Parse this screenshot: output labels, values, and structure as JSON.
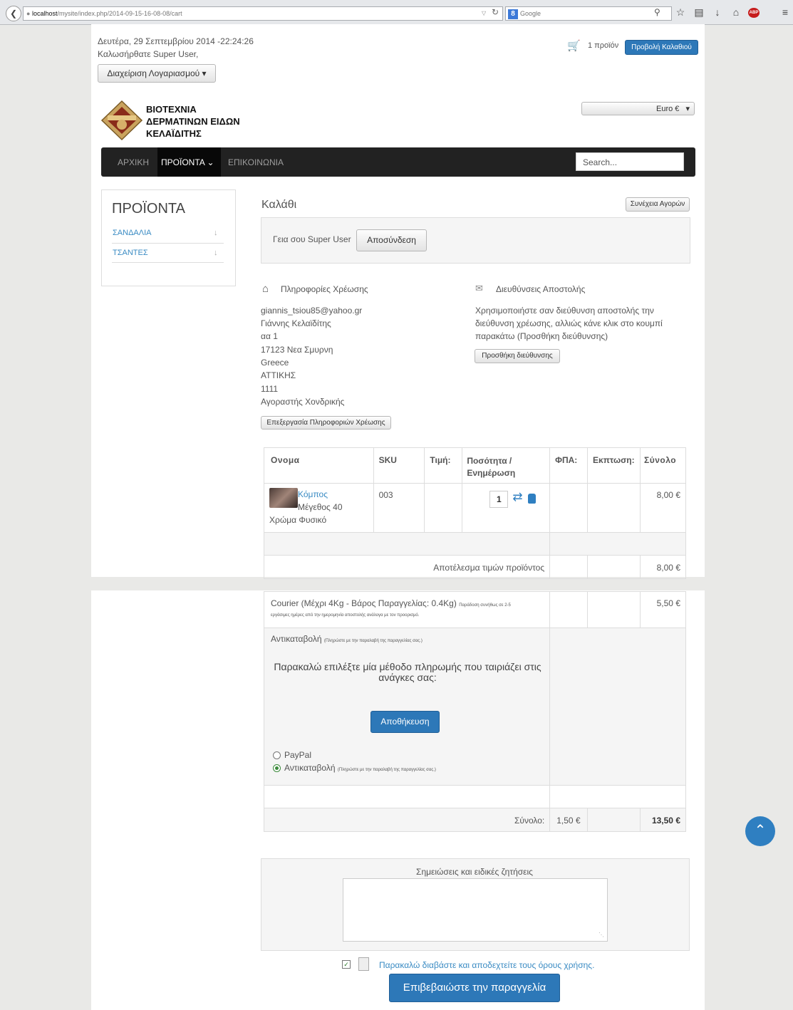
{
  "browser": {
    "url_host": "localhost",
    "url_path": "/mysite/index.php/2014-09-15-16-08-08/cart",
    "search_engine": "Google",
    "icons": [
      "back-icon",
      "reload-icon",
      "search-icon",
      "star-icon",
      "reading-list-icon",
      "download-icon",
      "home-icon",
      "adblock-icon",
      "menu-icon"
    ]
  },
  "top": {
    "date": "Δευτέρα, 29 Σεπτεμβρίου 2014 -22:24:26",
    "welcome": "Καλωσήρθατε Super User,",
    "account_button": "Διαχείριση Λογαριασμού",
    "cart_count": "1 προϊόν",
    "view_cart_button": "Προβολή Καλαθιού"
  },
  "logo": {
    "line1": "ΒΙΟΤΕΧΝΙΑ",
    "line2": "ΔΕΡΜΑΤΙΝΩΝ ΕΙΔΩΝ",
    "line3": "ΚΕΛΑΪΔΙΤΗΣ"
  },
  "currency": {
    "selected": "Euro €"
  },
  "nav": {
    "items": [
      "ΑΡΧΙΚΗ",
      "ΠΡΟΪΟΝΤΑ",
      "ΕΠΙΚΟΙΝΩΝΙΑ"
    ],
    "search_placeholder": "Search..."
  },
  "sidebar": {
    "title": "ΠΡΟΪΟΝΤΑ",
    "items": [
      "ΣΑΝΔΑΛΙΑ",
      "ΤΣΑΝΤΕΣ"
    ]
  },
  "cart": {
    "title": "Καλάθι",
    "continue_button": "Συνέχεια Αγορών",
    "greeting": "Γεια σου Super User",
    "logout_button": "Αποσύνδεση"
  },
  "billing": {
    "title": "Πληροφορίες Χρέωσης",
    "lines": [
      "giannis_tsiou85@yahoo.gr",
      "Γιάννης Κελαϊδίτης",
      "αα 1",
      "17123 Νεα Σμυρνη",
      "Greece",
      "ΑΤΤΙΚΗΣ",
      "1111",
      "Αγοραστής Χονδρικής"
    ],
    "edit_button": "Επεξεργασία Πληροφοριών Χρέωσης"
  },
  "shipping_address": {
    "title": "Διευθύνσεις Αποστολής",
    "text_lines": [
      "Χρησιμοποιήστε σαν διεύθυνση αποστολής την",
      "διεύθυνση χρέωσης, αλλιώς κάνε κλικ στο κουμπί",
      "παρακάτω (Προσθήκη διεύθυνσης)"
    ],
    "add_button": "Προσθήκη διεύθυνσης"
  },
  "table": {
    "headers": {
      "name": "Ονομα",
      "sku": "SKU",
      "price": "Τιμή:",
      "qty_line1": "Ποσότητα /",
      "qty_line2": "Ενημέρωση",
      "vat": "ΦΠΑ:",
      "discount": "Εκπτωση:",
      "total": "Σύνολο"
    },
    "item": {
      "name": "Κόμπος",
      "attr1": "Μέγεθος 40",
      "attr2": "Χρώμα Φυσικό",
      "sku": "003",
      "qty": "1",
      "total": "8,00 €"
    },
    "subtotal_label": "Αποτέλεσμα τιμών προϊόντος",
    "subtotal": "8,00 €",
    "shipping": {
      "name": "Courier (Μέχρι 4Kg - Βάρος Παραγγελίας: 0.4Kg)",
      "note_a": "Παράδοση συνήθως σε 2-5",
      "note_b": "εργάσιμες ημέρες από την ημερομηνία αποστολής ανάλογα με τον προορισμό.",
      "price": "5,50 €"
    },
    "payment": {
      "name": "Αντικαταβολή",
      "note": "(Πληρώστε με την παραλαβή της παραγγελίας σας.)",
      "prompt_line1": "Παρακαλώ επιλέξτε μία μέθοδο πληρωμής που ταιριάζει στις",
      "prompt_line2": "ανάγκες σας:",
      "save_button": "Αποθήκευση",
      "options": [
        "PayPal",
        "Αντικαταβολή"
      ],
      "option2_note": "(Πληρώστε με την παραλαβή της παραγγελίας σας.)",
      "selected": "Αντικαταβολή"
    },
    "total_label": "Σύνολο:",
    "total_vat": "1,50 €",
    "grand_total": "13,50 €"
  },
  "notes": {
    "label": "Σημειώσεις και ειδικές ζητήσεις",
    "value": ""
  },
  "terms": {
    "label": "Παρακαλώ διαβάστε και αποδεχτείτε τους όρους χρήσης.",
    "checked": true
  },
  "confirm_button": "Επιβεβαιώστε την παραγγελία",
  "colors": {
    "link": "#3a8bc3",
    "primary": "#2d78b8",
    "navbar": "#222222"
  }
}
